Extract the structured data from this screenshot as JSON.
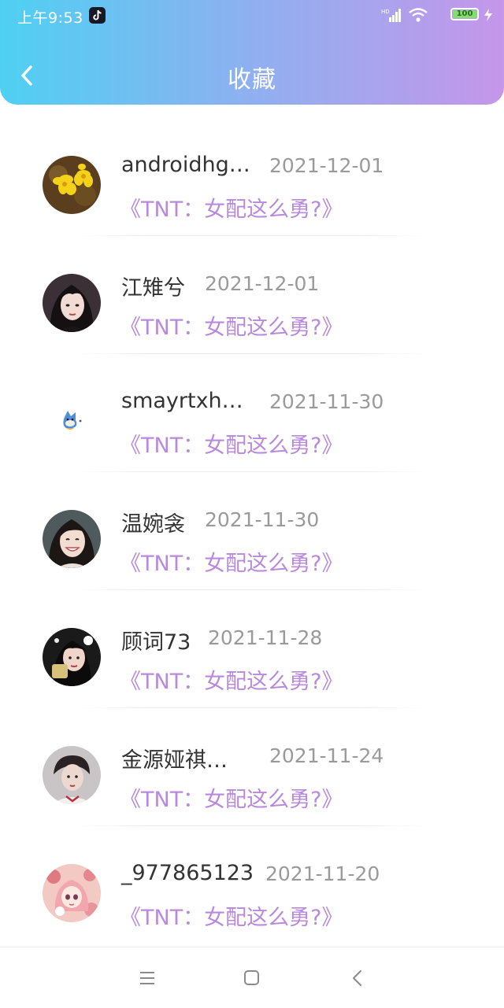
{
  "status_bar": {
    "time": "上午9:53",
    "battery": "100",
    "network": "HD"
  },
  "header": {
    "title": "收藏",
    "back_icon": "chevron-left-icon"
  },
  "favorites": [
    {
      "name": "androidhg…",
      "date": "2021-12-01",
      "book": "《TNT：女配这么勇?》",
      "avatar": "yellow-flowers"
    },
    {
      "name": "江雉兮",
      "date": "2021-12-01",
      "book": "《TNT：女配这么勇?》",
      "avatar": "dark-hair-girl"
    },
    {
      "name": "smayrtxh…",
      "date": "2021-11-30",
      "book": "《TNT：女配这么勇?》",
      "avatar": "cartoon-bird"
    },
    {
      "name": "温婉衾",
      "date": "2021-11-30",
      "book": "《TNT：女配这么勇?》",
      "avatar": "smiling-girl"
    },
    {
      "name": "顾词73",
      "date": "2021-11-28",
      "book": "《TNT：女配这么勇?》",
      "avatar": "girl-portrait"
    },
    {
      "name": "金源娅祺…",
      "date": "2021-11-24",
      "book": "《TNT：女配这么勇?》",
      "avatar": "boy-portrait"
    },
    {
      "name": "_977865123",
      "date": "2021-11-20",
      "book": "《TNT：女配这么勇?》",
      "avatar": "pink-anime-girl"
    }
  ],
  "colors": {
    "header_gradient_start": "#4fd0f3",
    "header_gradient_end": "#c596ea",
    "book_title": "#b889dc",
    "date": "#9a9a9a"
  },
  "nav_bar": {
    "menu_icon": "menu-icon",
    "home_icon": "home-square-icon",
    "back_icon": "back-triangle-icon"
  }
}
